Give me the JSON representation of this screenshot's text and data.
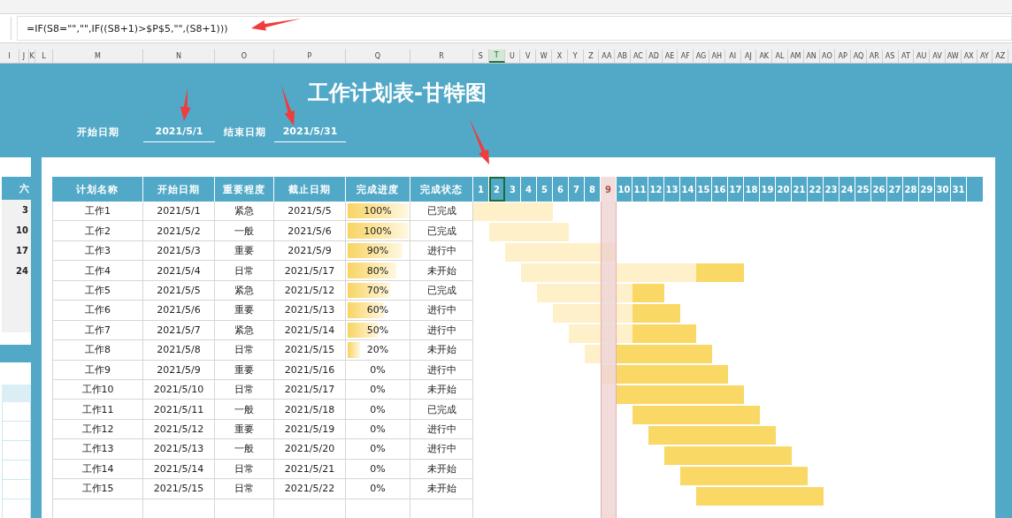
{
  "formula_bar": {
    "value": "=IF(S8=\"\",\"\",IF((S8+1)>$P$5,\"\",(S8+1)))"
  },
  "column_headers": [
    {
      "label": "I",
      "selected": false
    },
    {
      "label": "J",
      "selected": false
    },
    {
      "label": "K",
      "selected": false
    },
    {
      "label": "L",
      "selected": false
    },
    {
      "label": "M",
      "selected": false
    },
    {
      "label": "N",
      "selected": false
    },
    {
      "label": "O",
      "selected": false
    },
    {
      "label": "P",
      "selected": false
    },
    {
      "label": "Q",
      "selected": false
    },
    {
      "label": "R",
      "selected": false
    },
    {
      "label": "S",
      "selected": false
    },
    {
      "label": "T",
      "selected": true
    },
    {
      "label": "U",
      "selected": false
    },
    {
      "label": "V",
      "selected": false
    },
    {
      "label": "W",
      "selected": false
    },
    {
      "label": "X",
      "selected": false
    },
    {
      "label": "Y",
      "selected": false
    },
    {
      "label": "Z",
      "selected": false
    },
    {
      "label": "AA",
      "selected": false
    },
    {
      "label": "AB",
      "selected": false
    },
    {
      "label": "AC",
      "selected": false
    },
    {
      "label": "AD",
      "selected": false
    },
    {
      "label": "AE",
      "selected": false
    },
    {
      "label": "AF",
      "selected": false
    },
    {
      "label": "AG",
      "selected": false
    },
    {
      "label": "AH",
      "selected": false
    },
    {
      "label": "AI",
      "selected": false
    },
    {
      "label": "AJ",
      "selected": false
    },
    {
      "label": "AK",
      "selected": false
    },
    {
      "label": "AL",
      "selected": false
    },
    {
      "label": "AM",
      "selected": false
    },
    {
      "label": "AN",
      "selected": false
    },
    {
      "label": "AO",
      "selected": false
    },
    {
      "label": "AP",
      "selected": false
    },
    {
      "label": "AQ",
      "selected": false
    },
    {
      "label": "AR",
      "selected": false
    },
    {
      "label": "AS",
      "selected": false
    },
    {
      "label": "AT",
      "selected": false
    },
    {
      "label": "AU",
      "selected": false
    },
    {
      "label": "AV",
      "selected": false
    },
    {
      "label": "AW",
      "selected": false
    },
    {
      "label": "AX",
      "selected": false
    },
    {
      "label": "AY",
      "selected": false
    },
    {
      "label": "AZ",
      "selected": false
    }
  ],
  "title": "工作计划表-甘特图",
  "start_label": "开始日期",
  "start_value": "2021/5/1",
  "end_label": "结束日期",
  "end_value": "2021/5/31",
  "calendar": {
    "weekday_header": "六",
    "dates": [
      "3",
      "10",
      "17",
      "24"
    ]
  },
  "table": {
    "columns": [
      "计划名称",
      "开始日期",
      "重要程度",
      "截止日期",
      "完成进度",
      "完成状态"
    ],
    "rows": [
      {
        "name": "工作1",
        "start": "2021/5/1",
        "priority": "紧急",
        "end": "2021/5/5",
        "progress": "100%",
        "level": 1,
        "status": "已完成"
      },
      {
        "name": "工作2",
        "start": "2021/5/2",
        "priority": "一般",
        "end": "2021/5/6",
        "progress": "100%",
        "level": 1,
        "status": "已完成"
      },
      {
        "name": "工作3",
        "start": "2021/5/3",
        "priority": "重要",
        "end": "2021/5/9",
        "progress": "90%",
        "level": 0.9,
        "status": "进行中"
      },
      {
        "name": "工作4",
        "start": "2021/5/4",
        "priority": "日常",
        "end": "2021/5/17",
        "progress": "80%",
        "level": 0.8,
        "status": "未开始"
      },
      {
        "name": "工作5",
        "start": "2021/5/5",
        "priority": "紧急",
        "end": "2021/5/12",
        "progress": "70%",
        "level": 0.7,
        "status": "已完成"
      },
      {
        "name": "工作6",
        "start": "2021/5/6",
        "priority": "重要",
        "end": "2021/5/13",
        "progress": "60%",
        "level": 0.6,
        "status": "进行中"
      },
      {
        "name": "工作7",
        "start": "2021/5/7",
        "priority": "紧急",
        "end": "2021/5/14",
        "progress": "50%",
        "level": 0.5,
        "status": "进行中"
      },
      {
        "name": "工作8",
        "start": "2021/5/8",
        "priority": "日常",
        "end": "2021/5/15",
        "progress": "20%",
        "level": 0.2,
        "status": "未开始"
      },
      {
        "name": "工作9",
        "start": "2021/5/9",
        "priority": "重要",
        "end": "2021/5/16",
        "progress": "0%",
        "status": "进行中"
      },
      {
        "name": "工作10",
        "start": "2021/5/10",
        "priority": "日常",
        "end": "2021/5/17",
        "progress": "0%",
        "status": "未开始"
      },
      {
        "name": "工作11",
        "start": "2021/5/11",
        "priority": "一般",
        "end": "2021/5/18",
        "progress": "0%",
        "status": "已完成"
      },
      {
        "name": "工作12",
        "start": "2021/5/12",
        "priority": "重要",
        "end": "2021/5/19",
        "progress": "0%",
        "status": "进行中"
      },
      {
        "name": "工作13",
        "start": "2021/5/13",
        "priority": "一般",
        "end": "2021/5/20",
        "progress": "0%",
        "status": "进行中"
      },
      {
        "name": "工作14",
        "start": "2021/5/14",
        "priority": "日常",
        "end": "2021/5/21",
        "progress": "0%",
        "status": "未开始"
      },
      {
        "name": "工作15",
        "start": "2021/5/15",
        "priority": "日常",
        "end": "2021/5/22",
        "progress": "0%",
        "status": "未开始"
      }
    ]
  },
  "gantt": {
    "days": [
      {
        "label": "1",
        "selected": false,
        "today": false
      },
      {
        "label": "2",
        "selected": true,
        "today": false
      },
      {
        "label": "3",
        "selected": false,
        "today": false
      },
      {
        "label": "4",
        "selected": false,
        "today": false
      },
      {
        "label": "5",
        "selected": false,
        "today": false
      },
      {
        "label": "6",
        "selected": false,
        "today": false
      },
      {
        "label": "7",
        "selected": false,
        "today": false
      },
      {
        "label": "8",
        "selected": false,
        "today": false
      },
      {
        "label": "9",
        "selected": false,
        "today": true
      },
      {
        "label": "10",
        "selected": false,
        "today": false
      },
      {
        "label": "11",
        "selected": false,
        "today": false
      },
      {
        "label": "12",
        "selected": false,
        "today": false
      },
      {
        "label": "13",
        "selected": false,
        "today": false
      },
      {
        "label": "14",
        "selected": false,
        "today": false
      },
      {
        "label": "15",
        "selected": false,
        "today": false
      },
      {
        "label": "16",
        "selected": false,
        "today": false
      },
      {
        "label": "17",
        "selected": false,
        "today": false
      },
      {
        "label": "18",
        "selected": false,
        "today": false
      },
      {
        "label": "19",
        "selected": false,
        "today": false
      },
      {
        "label": "20",
        "selected": false,
        "today": false
      },
      {
        "label": "21",
        "selected": false,
        "today": false
      },
      {
        "label": "22",
        "selected": false,
        "today": false
      },
      {
        "label": "23",
        "selected": false,
        "today": false
      },
      {
        "label": "24",
        "selected": false,
        "today": false
      },
      {
        "label": "25",
        "selected": false,
        "today": false
      },
      {
        "label": "26",
        "selected": false,
        "today": false
      },
      {
        "label": "27",
        "selected": false,
        "today": false
      },
      {
        "label": "28",
        "selected": false,
        "today": false
      },
      {
        "label": "29",
        "selected": false,
        "today": false
      },
      {
        "label": "30",
        "selected": false,
        "today": false
      },
      {
        "label": "31",
        "selected": false,
        "today": false
      }
    ]
  }
}
